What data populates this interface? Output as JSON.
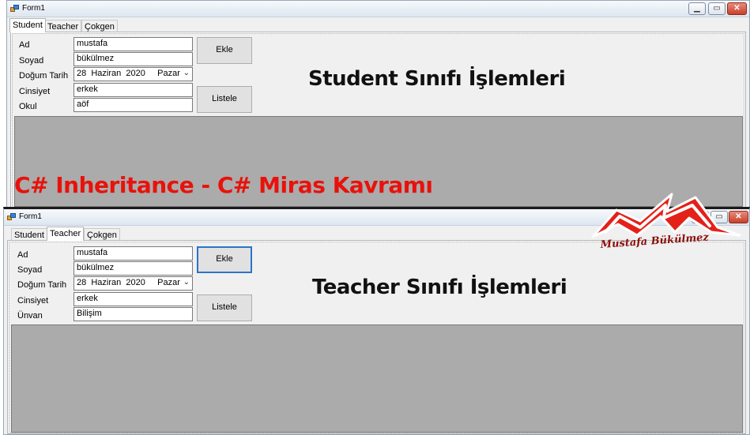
{
  "window1": {
    "title": "Form1",
    "tabs": [
      {
        "label": "Student"
      },
      {
        "label": "Teacher"
      },
      {
        "label": "Çokgen"
      }
    ],
    "active_tab": "Student",
    "fields": [
      {
        "label": "Ad",
        "value": "mustafa"
      },
      {
        "label": "Soyad",
        "value": "bükülmez"
      },
      {
        "label": "Doğum Tarih",
        "value": "28  Haziran  2020     Pazar"
      },
      {
        "label": "Cinsiyet",
        "value": "erkek"
      },
      {
        "label": "Okul",
        "value": "aöf"
      }
    ],
    "buttons": {
      "add": "Ekle",
      "list": "Listele"
    },
    "heading": "Student Sınıfı İşlemleri"
  },
  "window2": {
    "title": "Form1",
    "tabs": [
      {
        "label": "Student"
      },
      {
        "label": "Teacher"
      },
      {
        "label": "Çokgen"
      }
    ],
    "active_tab": "Teacher",
    "fields": [
      {
        "label": "Ad",
        "value": "mustafa"
      },
      {
        "label": "Soyad",
        "value": "bükülmez"
      },
      {
        "label": "Doğum Tarih",
        "value": "28  Haziran  2020     Pazar"
      },
      {
        "label": "Cinsiyet",
        "value": "erkek"
      },
      {
        "label": "Ünvan",
        "value": "Bilişim"
      }
    ],
    "buttons": {
      "add": "Ekle",
      "list": "Listele"
    },
    "heading": "Teacher Sınıfı İşlemleri"
  },
  "banner": "C# Inheritance - C# Miras Kavramı",
  "logo": {
    "signature_text": "Mustafa Bükülmez",
    "color": "#e32119"
  },
  "colors": {
    "grid": "#ababab",
    "banner": "#e8120b",
    "focus": "#2b74c7"
  }
}
